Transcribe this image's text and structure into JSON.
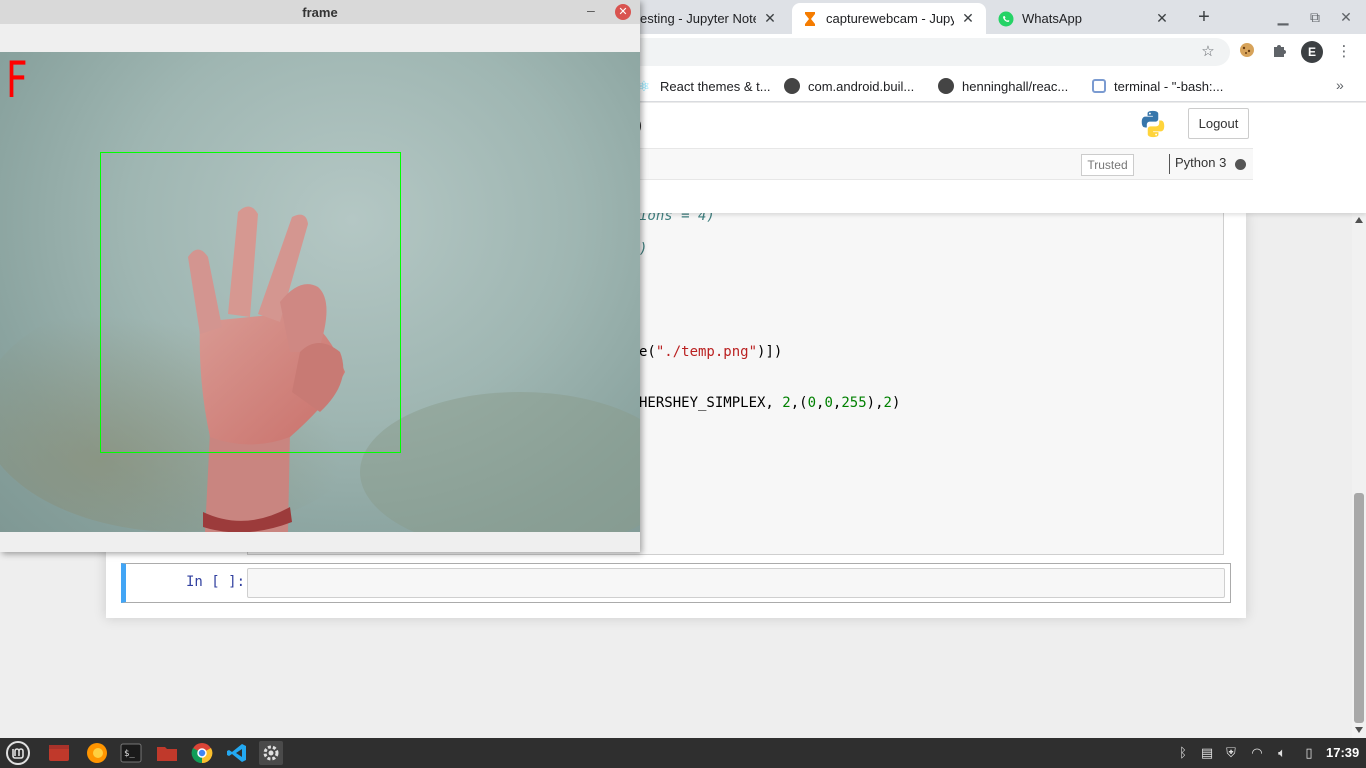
{
  "browser": {
    "tabs": [
      {
        "label": "esting - Jupyter Notel",
        "favicon": "jupyter-icon"
      },
      {
        "label": "capturewebcam - Jupy",
        "favicon": "hourglass-icon"
      },
      {
        "label": "WhatsApp",
        "favicon": "whatsapp-icon"
      }
    ],
    "close_glyph": "✕",
    "new_tab_glyph": "+",
    "bookmarks": [
      {
        "label": "React themes & t...",
        "icon": "react-icon"
      },
      {
        "label": "com.android.buil...",
        "icon": "github-icon"
      },
      {
        "label": "henninghall/reac...",
        "icon": "github-icon"
      },
      {
        "label": "terminal - \"-bash:...",
        "icon": "terminal-icon"
      }
    ],
    "bookmarks_more": "»"
  },
  "jupyter": {
    "title_fragment": ")",
    "logout_label": "Logout",
    "trusted_label": "Trusted",
    "kernel_name": "Python 3",
    "code_lines": [
      {
        "text": "ions = 4)",
        "kind": "comment"
      },
      {
        "text": ")",
        "kind": "comment"
      },
      {
        "pre": "e(",
        "str": "\"./temp.png\"",
        "post": ")])"
      },
      {
        "pre": "HERSHEY_SIMPLEX, ",
        "n1": "2",
        "mid1": ",(",
        "n2": "0",
        "c1": ",",
        "n3": "0",
        "c2": ",",
        "n4": "255",
        "mid2": "),",
        "n5": "2",
        "post": ")"
      }
    ],
    "new_cell_prompt": "In [ ]:"
  },
  "cv_window": {
    "title": "frame",
    "minimize_glyph": "–",
    "close_glyph": "✕",
    "prediction": "F"
  },
  "taskbar": {
    "apps": [
      "mint-menu-icon",
      "show-desktop-icon",
      "firefox-icon",
      "terminal-icon",
      "files-icon",
      "chrome-icon",
      "vscode-icon",
      "settings-icon"
    ],
    "clock": "17:39"
  },
  "colors": {
    "prediction_text": "#ff0000",
    "roi_box": "#00ff00",
    "cell_selected": "#42a5f5"
  }
}
